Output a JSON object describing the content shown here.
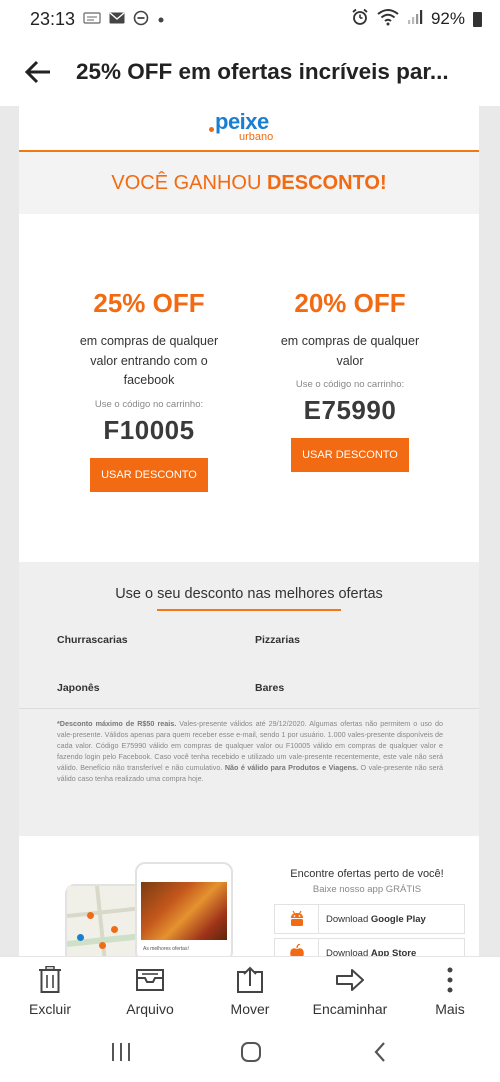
{
  "status_bar": {
    "time": "23:13",
    "battery": "92%",
    "icons": [
      "notification-icon",
      "mail-icon",
      "dnd-icon",
      "dot-icon",
      "alarm-icon",
      "wifi-icon",
      "signal-icon",
      "battery-icon"
    ]
  },
  "app_bar": {
    "title": "25% OFF em ofertas incríveis par..."
  },
  "email": {
    "logo": {
      "main": "peixe",
      "sub": "urbano"
    },
    "banner": {
      "text": "VOCÊ GANHOU ",
      "bold": "DESCONTO!"
    },
    "offers": [
      {
        "title": "25% OFF",
        "description": "em compras de qualquer valor entrando com o facebook",
        "hint": "Use o código no carrinho:",
        "code": "F10005",
        "button": "USAR DESCONTO"
      },
      {
        "title": "20% OFF",
        "description": "em compras de qualquer valor",
        "hint": "Use o código no carrinho:",
        "code": "E75990",
        "button": "USAR DESCONTO"
      }
    ],
    "best": {
      "title": "Use o seu desconto nas melhores ofertas",
      "categories": [
        "Churrascarias",
        "Pizzarias",
        "Japonês",
        "Bares"
      ]
    },
    "disclaimer": {
      "bold1": "*Desconto máximo de R$50 reais.",
      "text1": " Vales-presente válidos até 29/12/2020. Algumas ofertas não permitem o uso do vale-presente. Válidos apenas para quem receber esse e-mail, sendo 1 por usuário. 1.000 vales-presente disponíveis de cada valor. Código E75990 válido em compras de qualquer valor ou F10005 válido em compras de qualquer valor e fazendo login pelo Facebook. Caso você tenha recebido e utilizado um vale-presente recentemente, este vale não será válido. Benefício não transferível e não cumulativo. ",
      "bold2": "Não é válido para Produtos e Viagens.",
      "text2": " O vale-presente não será válido caso tenha realizado uma compra hoje."
    },
    "app_promo": {
      "title": "Encontre ofertas perto de você!",
      "subtitle": "Baixe nosso app GRÁTIS",
      "phone_caption": "As melhores ofertas!",
      "stores": [
        {
          "prefix": "Download ",
          "name": "Google Play"
        },
        {
          "prefix": "Download ",
          "name": "App Store"
        }
      ]
    }
  },
  "actions": [
    {
      "label": "Excluir",
      "icon": "trash-icon"
    },
    {
      "label": "Arquivo",
      "icon": "archive-icon"
    },
    {
      "label": "Mover",
      "icon": "move-icon"
    },
    {
      "label": "Encaminhar",
      "icon": "forward-icon"
    },
    {
      "label": "Mais",
      "icon": "more-vertical-icon"
    }
  ],
  "colors": {
    "accent": "#f26a11",
    "brand_blue": "#1b7fd1",
    "background_gray": "#efefef"
  }
}
